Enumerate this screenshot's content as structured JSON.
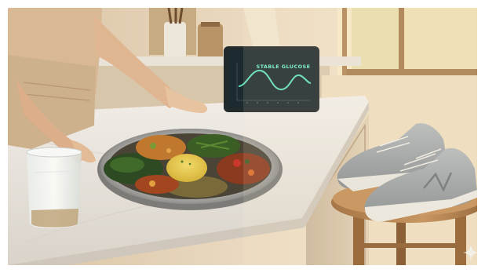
{
  "scene": {
    "tablet": {
      "screen_title": "STABLE GLUCOSE"
    },
    "colors": {
      "wall": "#ead9c0",
      "counter": "#ece8e1",
      "window_light": "#f6e9c6",
      "screen": "#1d2a2f",
      "graph_line": "#5fe0b8",
      "sneaker": "#9ba1a4",
      "stool": "#b07a45"
    }
  },
  "watermark": {
    "icon": "sparkle-icon"
  }
}
